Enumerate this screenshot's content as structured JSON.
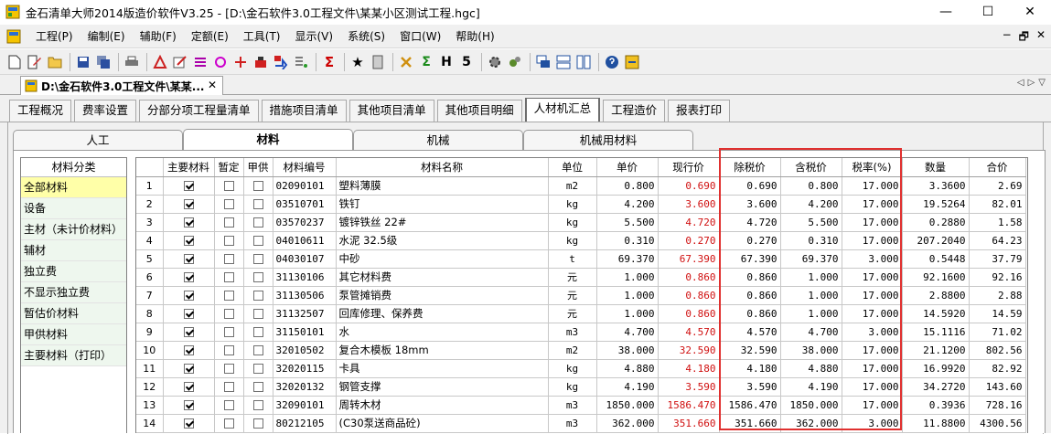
{
  "window": {
    "title": "金石清单大师2014版造价软件V3.25 - [D:\\金石软件3.0工程文件\\某某小区测试工程.hgc]",
    "minimize": "—",
    "maximize": "☐",
    "close": "✕"
  },
  "menu": {
    "items": [
      "工程(P)",
      "编制(E)",
      "辅助(F)",
      "定额(E)",
      "工具(T)",
      "显示(V)",
      "系统(S)",
      "窗口(W)",
      "帮助(H)"
    ],
    "mdi_minimize": "−",
    "mdi_restore": "🗗",
    "mdi_close": "✕"
  },
  "toolbar": {
    "glyphs": [
      "Σ",
      "★",
      "Σ",
      "H",
      "5"
    ]
  },
  "doc_tab": {
    "label": "D:\\金石软件3.0工程文件\\某某...",
    "close": "✕",
    "nav_left": "◁",
    "nav_right": "▷",
    "nav_down": "▽"
  },
  "main_tabs": [
    "工程概况",
    "费率设置",
    "分部分项工程量清单",
    "措施项目清单",
    "其他项目清单",
    "其他项目明细",
    "人材机汇总",
    "工程造价",
    "报表打印"
  ],
  "main_tabs_active": "人材机汇总",
  "sub_tabs": [
    "人工",
    "材料",
    "机械",
    "机械用材料"
  ],
  "sub_tabs_active": "材料",
  "category": {
    "header": "材料分类",
    "items": [
      "全部材料",
      "设备",
      "主材（未计价材料）",
      "辅材",
      "独立费",
      "不显示独立费",
      "暂估价材料",
      "甲供材料",
      "主要材料（打印）"
    ],
    "selected": "全部材料"
  },
  "grid": {
    "columns": [
      "",
      "主要材料",
      "暂定",
      "甲供",
      "材料编号",
      "材料名称",
      "单位",
      "单价",
      "现行价",
      "除税价",
      "含税价",
      "税率(%)",
      "数量",
      "合价"
    ],
    "rows": [
      {
        "no": "1",
        "main": true,
        "temp": false,
        "supply": false,
        "code": "02090101",
        "name": "塑料薄膜",
        "unit": "m2",
        "price": "0.800",
        "current": "0.690",
        "excl": "0.690",
        "incl": "0.800",
        "rate": "17.000",
        "qty": "3.3600",
        "total": "2.69"
      },
      {
        "no": "2",
        "main": true,
        "temp": false,
        "supply": false,
        "code": "03510701",
        "name": "铁钉",
        "unit": "kg",
        "price": "4.200",
        "current": "3.600",
        "excl": "3.600",
        "incl": "4.200",
        "rate": "17.000",
        "qty": "19.5264",
        "total": "82.01"
      },
      {
        "no": "3",
        "main": true,
        "temp": false,
        "supply": false,
        "code": "03570237",
        "name": "镀锌铁丝 22#",
        "unit": "kg",
        "price": "5.500",
        "current": "4.720",
        "excl": "4.720",
        "incl": "5.500",
        "rate": "17.000",
        "qty": "0.2880",
        "total": "1.58"
      },
      {
        "no": "4",
        "main": true,
        "temp": false,
        "supply": false,
        "code": "04010611",
        "name": "水泥 32.5级",
        "unit": "kg",
        "price": "0.310",
        "current": "0.270",
        "excl": "0.270",
        "incl": "0.310",
        "rate": "17.000",
        "qty": "207.2040",
        "total": "64.23"
      },
      {
        "no": "5",
        "main": true,
        "temp": false,
        "supply": false,
        "code": "04030107",
        "name": "中砂",
        "unit": "t",
        "price": "69.370",
        "current": "67.390",
        "excl": "67.390",
        "incl": "69.370",
        "rate": "3.000",
        "qty": "0.5448",
        "total": "37.79"
      },
      {
        "no": "6",
        "main": true,
        "temp": false,
        "supply": false,
        "code": "31130106",
        "name": "其它材料费",
        "unit": "元",
        "price": "1.000",
        "current": "0.860",
        "excl": "0.860",
        "incl": "1.000",
        "rate": "17.000",
        "qty": "92.1600",
        "total": "92.16"
      },
      {
        "no": "7",
        "main": true,
        "temp": false,
        "supply": false,
        "code": "31130506",
        "name": "泵管摊销费",
        "unit": "元",
        "price": "1.000",
        "current": "0.860",
        "excl": "0.860",
        "incl": "1.000",
        "rate": "17.000",
        "qty": "2.8800",
        "total": "2.88"
      },
      {
        "no": "8",
        "main": true,
        "temp": false,
        "supply": false,
        "code": "31132507",
        "name": "回库修理、保养费",
        "unit": "元",
        "price": "1.000",
        "current": "0.860",
        "excl": "0.860",
        "incl": "1.000",
        "rate": "17.000",
        "qty": "14.5920",
        "total": "14.59"
      },
      {
        "no": "9",
        "main": true,
        "temp": false,
        "supply": false,
        "code": "31150101",
        "name": "水",
        "unit": "m3",
        "price": "4.700",
        "current": "4.570",
        "excl": "4.570",
        "incl": "4.700",
        "rate": "3.000",
        "qty": "15.1116",
        "total": "71.02"
      },
      {
        "no": "10",
        "main": true,
        "temp": false,
        "supply": false,
        "code": "32010502",
        "name": "复合木模板 18mm",
        "unit": "m2",
        "price": "38.000",
        "current": "32.590",
        "excl": "32.590",
        "incl": "38.000",
        "rate": "17.000",
        "qty": "21.1200",
        "total": "802.56"
      },
      {
        "no": "11",
        "main": true,
        "temp": false,
        "supply": false,
        "code": "32020115",
        "name": "卡具",
        "unit": "kg",
        "price": "4.880",
        "current": "4.180",
        "excl": "4.180",
        "incl": "4.880",
        "rate": "17.000",
        "qty": "16.9920",
        "total": "82.92"
      },
      {
        "no": "12",
        "main": true,
        "temp": false,
        "supply": false,
        "code": "32020132",
        "name": "钢管支撑",
        "unit": "kg",
        "price": "4.190",
        "current": "3.590",
        "excl": "3.590",
        "incl": "4.190",
        "rate": "17.000",
        "qty": "34.2720",
        "total": "143.60"
      },
      {
        "no": "13",
        "main": true,
        "temp": false,
        "supply": false,
        "code": "32090101",
        "name": "周转木材",
        "unit": "m3",
        "price": "1850.000",
        "current": "1586.470",
        "excl": "1586.470",
        "incl": "1850.000",
        "rate": "17.000",
        "qty": "0.3936",
        "total": "728.16"
      },
      {
        "no": "14",
        "main": true,
        "temp": false,
        "supply": false,
        "code": "80212105",
        "name": "(C30泵送商品砼)",
        "unit": "m3",
        "price": "362.000",
        "current": "351.660",
        "excl": "351.660",
        "incl": "362.000",
        "rate": "3.000",
        "qty": "11.8800",
        "total": "4300.56"
      }
    ]
  },
  "colors": {
    "accent_red": "#e0302f",
    "selected_category": "#ffffa8",
    "current_price_text": "#d01010"
  }
}
